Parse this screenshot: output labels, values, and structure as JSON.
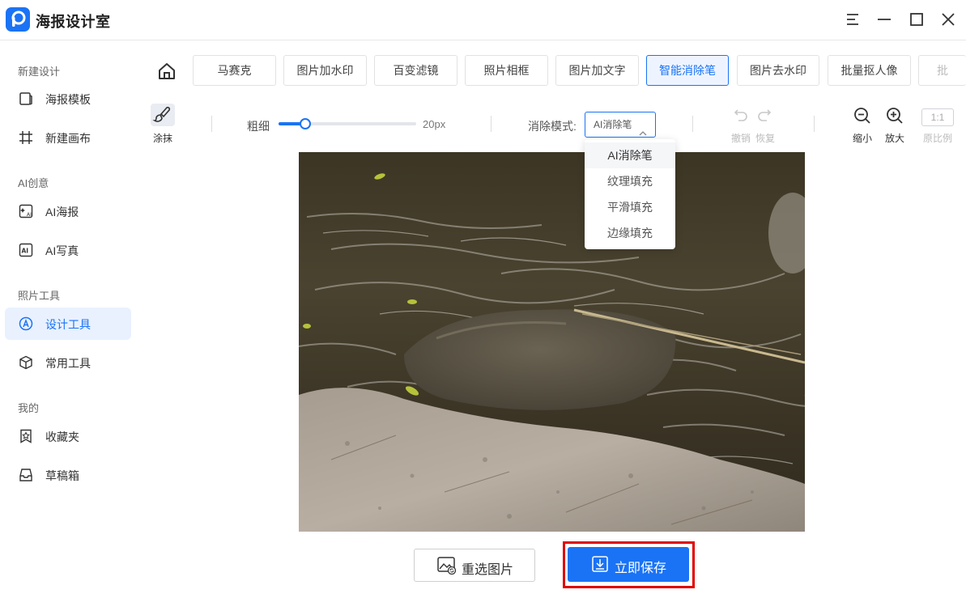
{
  "app": {
    "title": "海报设计室"
  },
  "sidebar": {
    "sections": [
      {
        "title": "新建设计",
        "items": [
          {
            "label": "海报模板",
            "icon": "template-icon"
          },
          {
            "label": "新建画布",
            "icon": "canvas-icon"
          }
        ]
      },
      {
        "title": "AI创意",
        "items": [
          {
            "label": "AI海报",
            "icon": "ai-poster-icon"
          },
          {
            "label": "AI写真",
            "icon": "ai-photo-icon"
          }
        ]
      },
      {
        "title": "照片工具",
        "items": [
          {
            "label": "设计工具",
            "icon": "design-tool-icon",
            "active": true
          },
          {
            "label": "常用工具",
            "icon": "cube-icon"
          }
        ]
      },
      {
        "title": "我的",
        "items": [
          {
            "label": "收藏夹",
            "icon": "favorites-icon"
          },
          {
            "label": "草稿箱",
            "icon": "drafts-icon"
          }
        ]
      }
    ]
  },
  "tabs": [
    "马赛克",
    "图片加水印",
    "百变滤镜",
    "照片相框",
    "图片加文字",
    "智能消除笔",
    "图片去水印",
    "批量抠人像",
    "批"
  ],
  "active_tab": "智能消除笔",
  "toolbar": {
    "smear_label": "涂抹",
    "thickness_label": "粗细",
    "thickness_value": "20px",
    "thickness_fraction": 0.2,
    "mode_label": "消除模式:",
    "mode_selected": "AI消除笔",
    "mode_options": [
      "AI消除笔",
      "纹理填充",
      "平滑填充",
      "边缘填充"
    ],
    "undo_label": "撤销",
    "redo_label": "恢复",
    "zoom_out_label": "缩小",
    "zoom_in_label": "放大",
    "ratio_box": "1:1",
    "original_ratio_label": "原比例"
  },
  "actions": {
    "reselect_label": "重选图片",
    "save_label": "立即保存"
  },
  "colors": {
    "accent": "#1a73f5",
    "highlight": "#e00000"
  }
}
